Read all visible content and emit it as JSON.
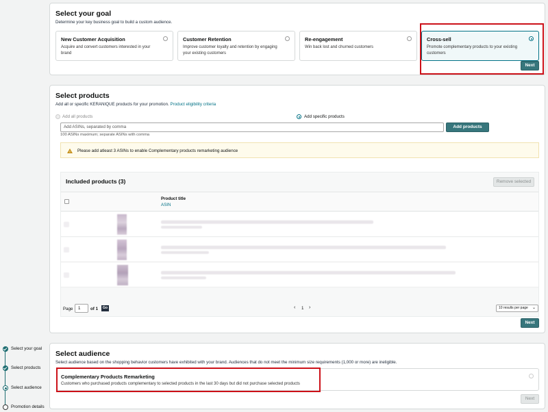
{
  "goal": {
    "title": "Select your goal",
    "subtitle": "Determine your key business goal to build a custom audience.",
    "options": [
      {
        "title": "New Customer Acquisition",
        "desc": "Acquire and convert customers interested in your brand",
        "selected": false
      },
      {
        "title": "Customer Retention",
        "desc": "Improve customer loyalty and retention by engaging your existing customers",
        "selected": false
      },
      {
        "title": "Re-engagement",
        "desc": "Win back lost and churned customers",
        "selected": false
      },
      {
        "title": "Cross-sell",
        "desc": "Promote complementary products to your existing customers",
        "selected": true
      }
    ],
    "next_label": "Next"
  },
  "products": {
    "title": "Select products",
    "subtitle_prefix": "Add all or specific KERANIQUE products for your promotion.",
    "subtitle_link": "Product eligibility criteria",
    "radio_all": "Add all products",
    "radio_specific": "Add specific products",
    "asin_placeholder": "Add ASINs, separated by comma",
    "asin_hint": "100 ASINs maximum; separate ASINs with comma",
    "add_button": "Add products",
    "alert": "Please add atleast 3 ASINs to enable Complementary products remarketing audience",
    "included_title": "Included products (3)",
    "remove_button": "Remove selected",
    "col_title": "Product title",
    "col_asin": "ASIN",
    "pagination": {
      "page_label": "Page",
      "page_value": "1",
      "of_label": "of",
      "total": "1",
      "go_label": "Go",
      "current_page": "1",
      "per_page": "10 results per page"
    },
    "next_label": "Next"
  },
  "audience": {
    "title": "Select audience",
    "subtitle": "Select audience based on the shopping behavior customers have exhibited with your brand. Audiences that do not meet the minimum size requirements (1,000 or more) are ineligible.",
    "option_title": "Complementary Products Remarketing",
    "option_desc": "Customers who purchased products complementary to selected products in the last 30 days but did not purchase selected products",
    "next_label": "Next"
  },
  "sidebar": {
    "steps": [
      {
        "label": "Select your goal",
        "state": "done"
      },
      {
        "label": "Select products",
        "state": "done"
      },
      {
        "label": "Select audience",
        "state": "current"
      },
      {
        "label": "Promotion details",
        "state": "todo"
      }
    ]
  },
  "colors": {
    "accent": "#37767c",
    "highlight": "#cc1018",
    "alert_bg": "#fefbec"
  }
}
